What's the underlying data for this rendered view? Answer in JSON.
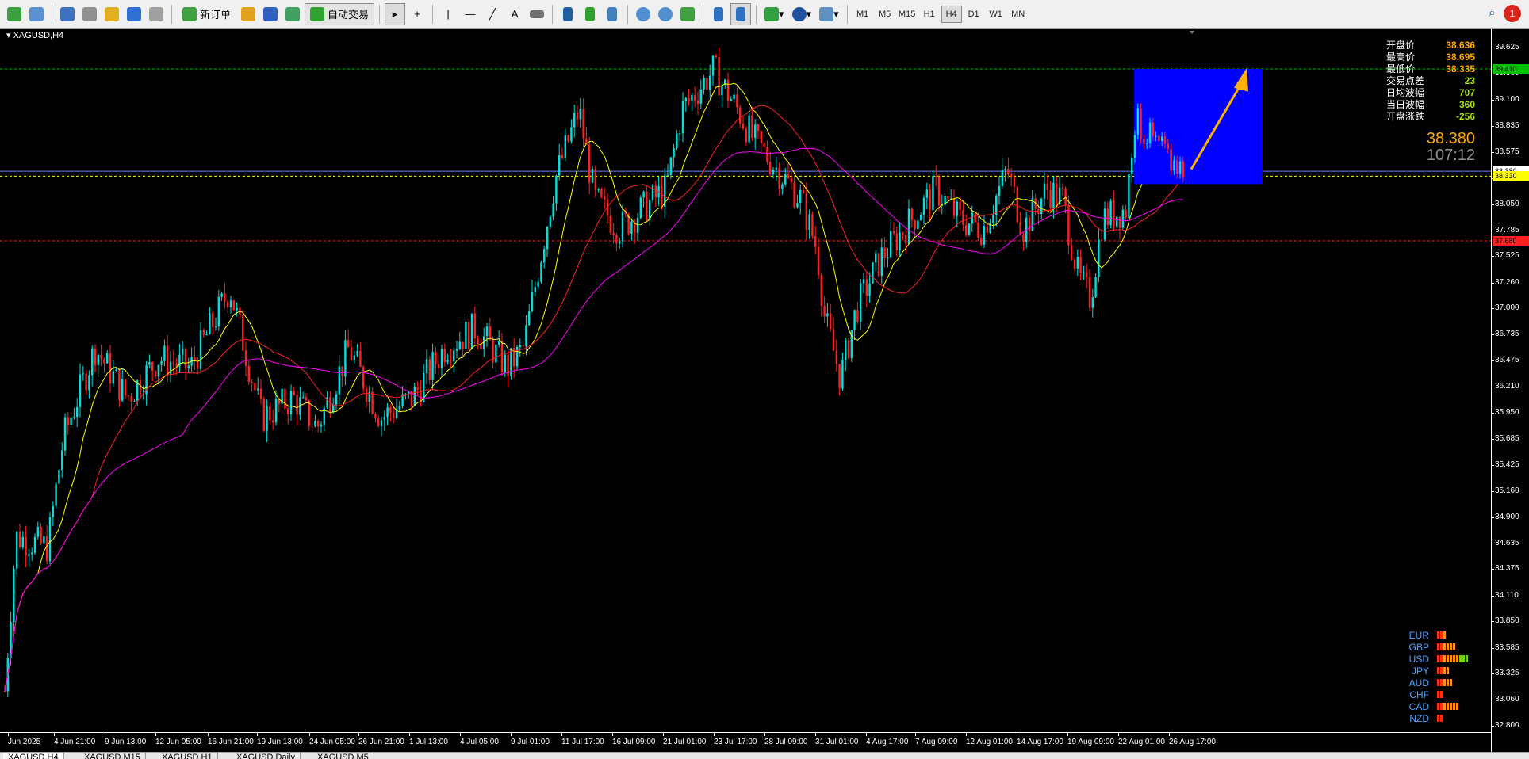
{
  "toolbar": {
    "new_order_label": "新订单",
    "auto_trade_label": "自动交易",
    "timeframes": [
      "M1",
      "M5",
      "M15",
      "H1",
      "H4",
      "D1",
      "W1",
      "MN"
    ],
    "active_timeframe": "H4",
    "notifications_count": "1",
    "icons": [
      "new-chart-icon",
      "profiles-icon",
      "market-watch-icon",
      "navigator-icon",
      "favorites-icon",
      "data-window-icon",
      "history-icon",
      "new-order-icon",
      "gold-icon",
      "signals-icon",
      "market-icon",
      "auto-trading-icon",
      "cursor-icon",
      "crosshair-icon",
      "vertical-line-icon",
      "horizontal-line-icon",
      "trendline-icon",
      "text-icon",
      "label-icon",
      "bar-chart-icon",
      "candlestick-icon",
      "line-chart-icon",
      "zoom-in-icon",
      "zoom-out-icon",
      "tile-windows-icon",
      "autoscroll-icon",
      "chart-shift-icon",
      "indicators-icon",
      "periods-icon",
      "templates-icon",
      "search-icon"
    ]
  },
  "chart": {
    "symbol_label": "XAGUSD,H4",
    "info_panel": [
      {
        "label": "开盘价",
        "value": "38.636",
        "color": "#ffa500"
      },
      {
        "label": "最高价",
        "value": "38.695",
        "color": "#ffa500"
      },
      {
        "label": "最低价",
        "value": "38.335",
        "color": "#ffa500"
      },
      {
        "label": "交易点差",
        "value": "23",
        "color": "#a8e000"
      },
      {
        "label": "日均波幅",
        "value": "707",
        "color": "#a8e000"
      },
      {
        "label": "当日波幅",
        "value": "360",
        "color": "#a8e000"
      },
      {
        "label": "开盘涨跌",
        "value": "-256",
        "color": "#a8e000"
      }
    ],
    "current_price": "38.380",
    "countdown": "107:12",
    "currency_strength": [
      {
        "name": "EUR",
        "bars": 3
      },
      {
        "name": "GBP",
        "bars": 6
      },
      {
        "name": "USD",
        "bars": 10
      },
      {
        "name": "JPY",
        "bars": 4
      },
      {
        "name": "AUD",
        "bars": 5
      },
      {
        "name": "CHF",
        "bars": 2
      },
      {
        "name": "CAD",
        "bars": 7
      },
      {
        "name": "NZD",
        "bars": 2
      }
    ],
    "price_ticks": [
      "39.625",
      "39.360",
      "39.100",
      "38.835",
      "38.575",
      "38.310",
      "38.050",
      "37.785",
      "37.525",
      "37.260",
      "37.000",
      "36.735",
      "36.475",
      "36.210",
      "35.950",
      "35.685",
      "35.425",
      "35.160",
      "34.900",
      "34.635",
      "34.375",
      "34.110",
      "33.850",
      "33.585",
      "33.325",
      "33.060",
      "32.800"
    ],
    "price_labels": [
      {
        "value": "39.410",
        "color": "#00c000"
      },
      {
        "value": "38.380",
        "color": "#ffffff"
      },
      {
        "value": "38.330",
        "color": "#ffff00"
      },
      {
        "value": "37.680",
        "color": "#ff2020"
      }
    ],
    "time_ticks": [
      "Jun 2025",
      "4 Jun 21:00",
      "9 Jun 13:00",
      "12 Jun 05:00",
      "16 Jun 21:00",
      "19 Jun 13:00",
      "24 Jun 05:00",
      "26 Jun 21:00",
      "1 Jul 13:00",
      "4 Jul 05:00",
      "9 Jul 01:00",
      "11 Jul 17:00",
      "16 Jul 09:00",
      "21 Jul 01:00",
      "23 Jul 17:00",
      "28 Jul 09:00",
      "31 Jul 01:00",
      "4 Aug 17:00",
      "7 Aug 09:00",
      "12 Aug 01:00",
      "14 Aug 17:00",
      "19 Aug 09:00",
      "22 Aug 01:00",
      "26 Aug 17:00"
    ],
    "series_colors": {
      "ma_fast": "#ffff00",
      "ma_mid": "#ff2020",
      "ma_slow": "#ff00ff",
      "bull": "#00e0e0",
      "bear": "#ff2020"
    },
    "annotation_box_color": "#0000ff",
    "arrow_color": "#ffb000"
  },
  "tabs": [
    "XAGUSD,H4",
    "XAGUSD,M15",
    "XAGUSD,H1",
    "XAGUSD,Daily",
    "XAGUSD,M5"
  ]
}
